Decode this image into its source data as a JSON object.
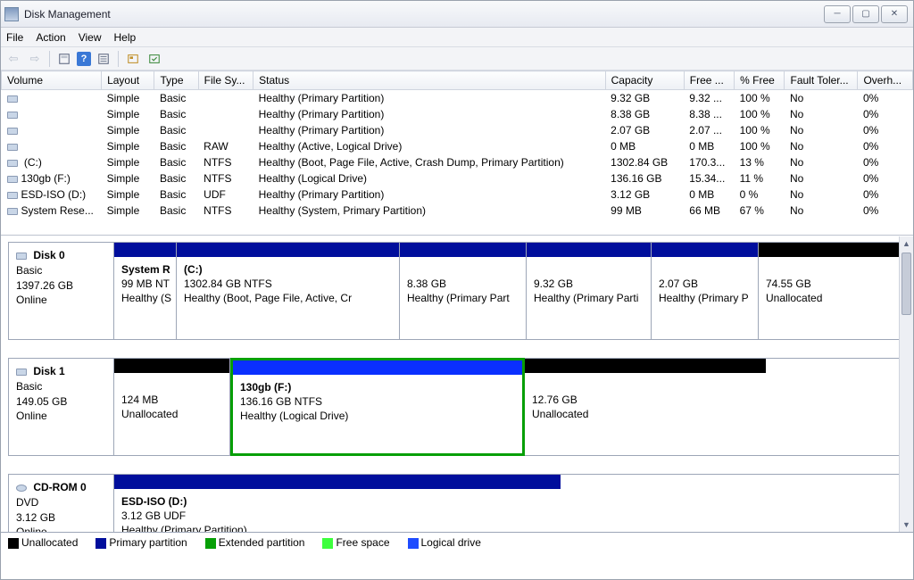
{
  "window": {
    "title": "Disk Management"
  },
  "menu": {
    "file": "File",
    "action": "Action",
    "view": "View",
    "help": "Help"
  },
  "table": {
    "headers": {
      "volume": "Volume",
      "layout": "Layout",
      "type": "Type",
      "filesys": "File Sy...",
      "status": "Status",
      "capacity": "Capacity",
      "free": "Free ...",
      "pctfree": "% Free",
      "fault": "Fault Toler...",
      "overhead": "Overh..."
    },
    "rows": [
      {
        "volume": "",
        "layout": "Simple",
        "type": "Basic",
        "filesys": "",
        "status": "Healthy (Primary Partition)",
        "capacity": "9.32 GB",
        "free": "9.32 ...",
        "pctfree": "100 %",
        "fault": "No",
        "overhead": "0%"
      },
      {
        "volume": "",
        "layout": "Simple",
        "type": "Basic",
        "filesys": "",
        "status": "Healthy (Primary Partition)",
        "capacity": "8.38 GB",
        "free": "8.38 ...",
        "pctfree": "100 %",
        "fault": "No",
        "overhead": "0%"
      },
      {
        "volume": "",
        "layout": "Simple",
        "type": "Basic",
        "filesys": "",
        "status": "Healthy (Primary Partition)",
        "capacity": "2.07 GB",
        "free": "2.07 ...",
        "pctfree": "100 %",
        "fault": "No",
        "overhead": "0%"
      },
      {
        "volume": "",
        "layout": "Simple",
        "type": "Basic",
        "filesys": "RAW",
        "status": "Healthy (Active, Logical Drive)",
        "capacity": "0 MB",
        "free": "0 MB",
        "pctfree": "100 %",
        "fault": "No",
        "overhead": "0%"
      },
      {
        "volume": " (C:)",
        "layout": "Simple",
        "type": "Basic",
        "filesys": "NTFS",
        "status": "Healthy (Boot, Page File, Active, Crash Dump, Primary Partition)",
        "capacity": "1302.84 GB",
        "free": "170.3...",
        "pctfree": "13 %",
        "fault": "No",
        "overhead": "0%"
      },
      {
        "volume": "130gb (F:)",
        "layout": "Simple",
        "type": "Basic",
        "filesys": "NTFS",
        "status": "Healthy (Logical Drive)",
        "capacity": "136.16 GB",
        "free": "15.34...",
        "pctfree": "11 %",
        "fault": "No",
        "overhead": "0%"
      },
      {
        "volume": "ESD-ISO (D:)",
        "layout": "Simple",
        "type": "Basic",
        "filesys": "UDF",
        "status": "Healthy (Primary Partition)",
        "capacity": "3.12 GB",
        "free": "0 MB",
        "pctfree": "0 %",
        "fault": "No",
        "overhead": "0%"
      },
      {
        "volume": "System Rese...",
        "layout": "Simple",
        "type": "Basic",
        "filesys": "NTFS",
        "status": "Healthy (System, Primary Partition)",
        "capacity": "99 MB",
        "free": "66 MB",
        "pctfree": "67 %",
        "fault": "No",
        "overhead": "0%"
      }
    ]
  },
  "disks": {
    "d0": {
      "name": "Disk 0",
      "type": "Basic",
      "size": "1397.26 GB",
      "state": "Online",
      "parts": [
        {
          "title": "System R",
          "line2": "99 MB NT",
          "line3": "Healthy (S"
        },
        {
          "title": " (C:)",
          "line2": "1302.84 GB NTFS",
          "line3": "Healthy (Boot, Page File, Active, Cr"
        },
        {
          "title": "",
          "line2": "8.38 GB",
          "line3": "Healthy (Primary Part"
        },
        {
          "title": "",
          "line2": "9.32 GB",
          "line3": "Healthy (Primary Parti"
        },
        {
          "title": "",
          "line2": "2.07 GB",
          "line3": "Healthy (Primary P"
        },
        {
          "title": "",
          "line2": "74.55 GB",
          "line3": "Unallocated"
        }
      ]
    },
    "d1": {
      "name": "Disk 1",
      "type": "Basic",
      "size": "149.05 GB",
      "state": "Online",
      "parts": [
        {
          "title": "",
          "line2": "124 MB",
          "line3": "Unallocated"
        },
        {
          "title": "130gb  (F:)",
          "line2": "136.16 GB NTFS",
          "line3": "Healthy (Logical Drive)"
        },
        {
          "title": "",
          "line2": "12.76 GB",
          "line3": "Unallocated"
        }
      ]
    },
    "cd0": {
      "name": "CD-ROM 0",
      "type": "DVD",
      "size": "3.12 GB",
      "state": "Online",
      "parts": [
        {
          "title": "ESD-ISO  (D:)",
          "line2": "3.12 GB UDF",
          "line3": "Healthy (Primary Partition)"
        }
      ]
    }
  },
  "legend": {
    "unallocated": "Unallocated",
    "primary": "Primary partition",
    "extended": "Extended partition",
    "free": "Free space",
    "logical": "Logical drive"
  }
}
